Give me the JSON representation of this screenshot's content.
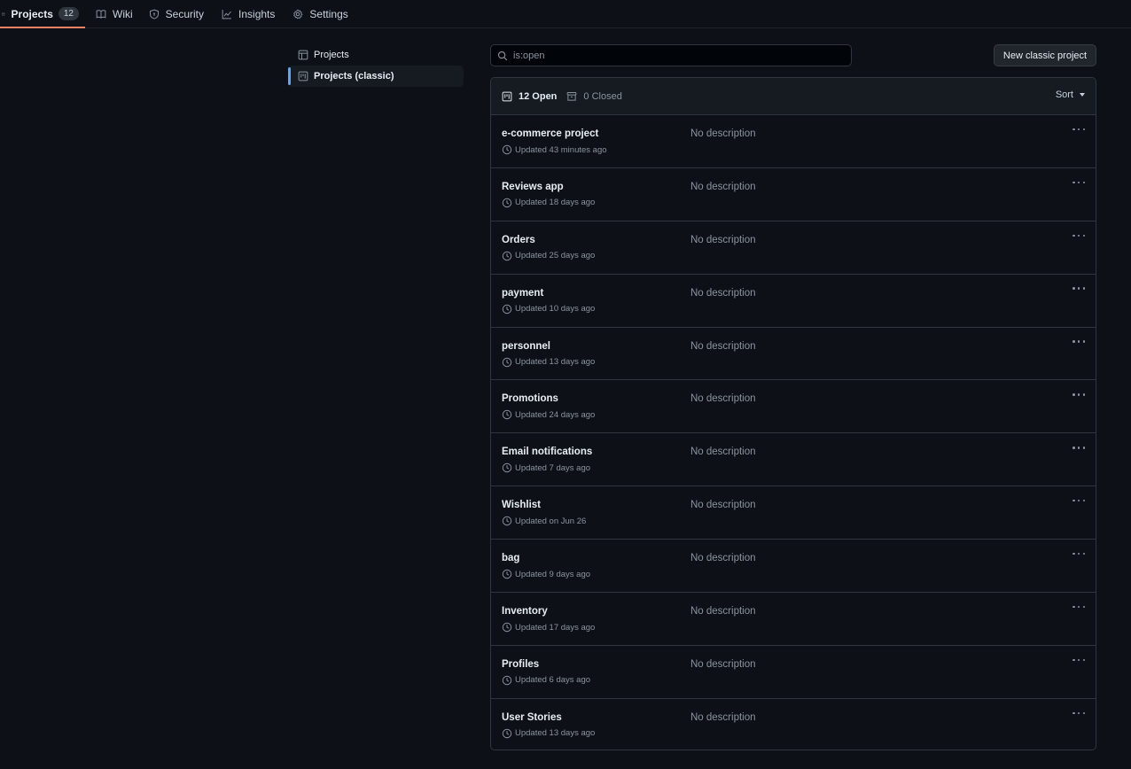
{
  "nav": {
    "tabs": [
      {
        "label": "Projects",
        "count": "12",
        "icon": "table-icon"
      },
      {
        "label": "Wiki",
        "icon": "book-icon"
      },
      {
        "label": "Security",
        "icon": "shield-icon"
      },
      {
        "label": "Insights",
        "icon": "graph-icon"
      },
      {
        "label": "Settings",
        "icon": "gear-icon"
      }
    ]
  },
  "sidenav": {
    "items": [
      {
        "label": "Projects",
        "icon": "table-icon"
      },
      {
        "label": "Projects (classic)",
        "icon": "project-board-icon",
        "selected": true
      }
    ]
  },
  "search": {
    "value": "is:open",
    "placeholder": "is:open"
  },
  "new_button": "New classic project",
  "list": {
    "open_label": "12 Open",
    "closed_label": "0 Closed",
    "sort_label": "Sort",
    "projects": [
      {
        "name": "e-commerce project",
        "updated": "Updated 43 minutes ago",
        "description": "No description"
      },
      {
        "name": "Reviews app",
        "updated": "Updated 18 days ago",
        "description": "No description"
      },
      {
        "name": "Orders",
        "updated": "Updated 25 days ago",
        "description": "No description"
      },
      {
        "name": "payment",
        "updated": "Updated 10 days ago",
        "description": "No description"
      },
      {
        "name": "personnel",
        "updated": "Updated 13 days ago",
        "description": "No description"
      },
      {
        "name": "Promotions",
        "updated": "Updated 24 days ago",
        "description": "No description"
      },
      {
        "name": "Email notifications",
        "updated": "Updated 7 days ago",
        "description": "No description"
      },
      {
        "name": "Wishlist",
        "updated": "Updated on Jun 26",
        "description": "No description"
      },
      {
        "name": "bag",
        "updated": "Updated 9 days ago",
        "description": "No description"
      },
      {
        "name": "Inventory",
        "updated": "Updated 17 days ago",
        "description": "No description"
      },
      {
        "name": "Profiles",
        "updated": "Updated 6 days ago",
        "description": "No description"
      },
      {
        "name": "User Stories",
        "updated": "Updated 13 days ago",
        "description": "No description"
      }
    ]
  },
  "colors": {
    "background": "#0d1117",
    "accent_underline": "#f78166",
    "selected_bar": "#58a6ff"
  }
}
